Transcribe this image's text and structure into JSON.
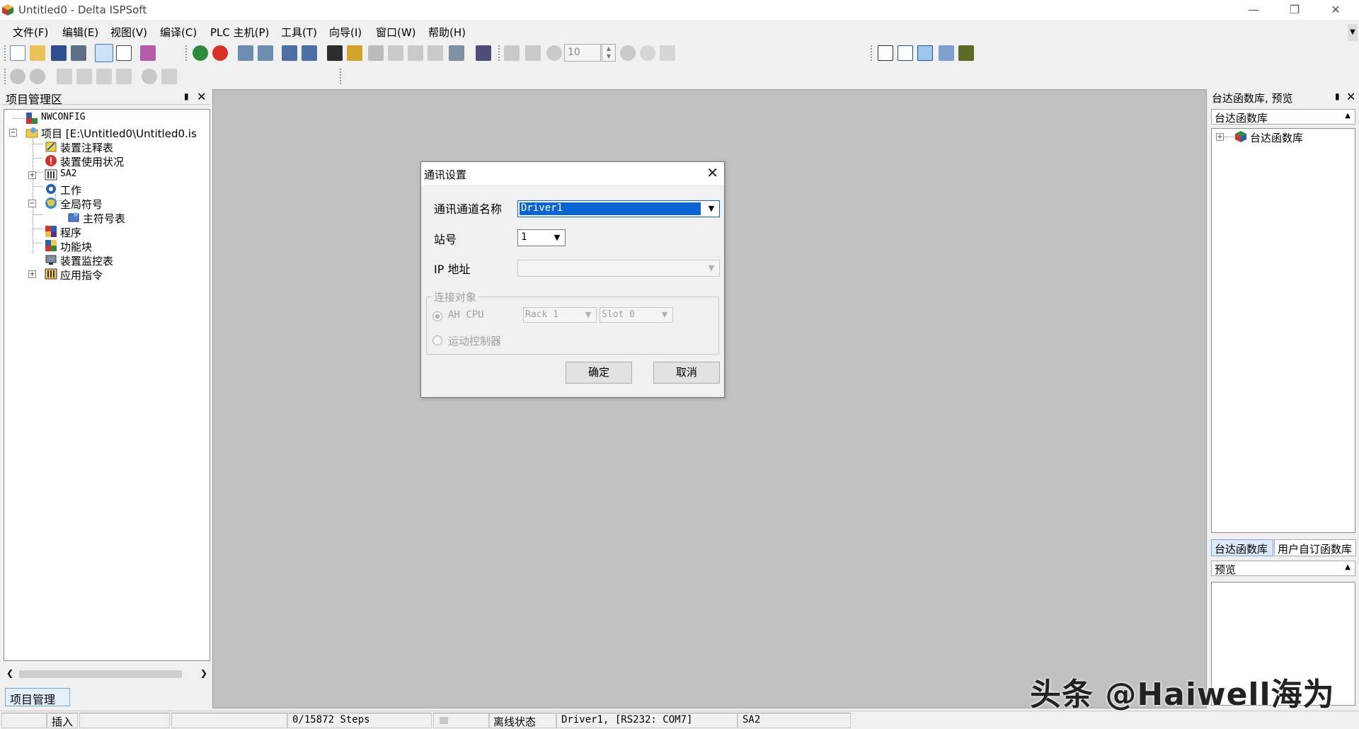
{
  "window": {
    "title": "Untitled0 - Delta ISPSoft"
  },
  "menu": [
    "文件(F)",
    "编辑(E)",
    "视图(V)",
    "编译(C)",
    "PLC 主机(P)",
    "工具(T)",
    "向导(I)",
    "窗口(W)",
    "帮助(H)"
  ],
  "toolbar": {
    "step_value": "10"
  },
  "left_panel": {
    "title": "项目管理区",
    "tab_label": "项目管理区",
    "tree": {
      "nwconfig": "NWCONFIG",
      "project": "项目 [E:\\Untitled0\\Untitled0.is",
      "device_comment": "装置注释表",
      "device_usage": "装置使用状况",
      "sa2": "SA2",
      "tasks": "工作",
      "global_symbols": "全局符号",
      "main_symbol_table": "主符号表",
      "programs": "程序",
      "function_blocks": "功能块",
      "device_monitor": "装置监控表",
      "app_instructions": "应用指令"
    }
  },
  "dialog": {
    "title": "通讯设置",
    "channel_label": "通讯通道名称",
    "channel_value": "Driver1",
    "station_label": "站号",
    "station_value": "1",
    "ip_label": "IP 地址",
    "ip_value": "",
    "group_title": "连接对象",
    "radio_ah_cpu": "AH CPU",
    "rack_value": "Rack 1",
    "slot_value": "Slot 0",
    "radio_motion": "运动控制器",
    "ok": "确定",
    "cancel": "取消"
  },
  "right_panel": {
    "title": "台达函数库, 预览",
    "lib_header": "台达函数库",
    "lib_root": "台达函数库",
    "tab_delta": "台达函数库",
    "tab_user": "用户自订函数库",
    "preview_header": "预览"
  },
  "status": {
    "mode": "插入",
    "steps": "0/15872 Steps",
    "connection": "离线状态",
    "driver": "Driver1, [RS232: COM7]",
    "model": "SA2"
  },
  "watermark": "头条 @Haiwell海为",
  "colors": {
    "workspace": "#c0c0c0",
    "selection": "#0a64d2",
    "panel_bg": "#f0f0f0"
  }
}
